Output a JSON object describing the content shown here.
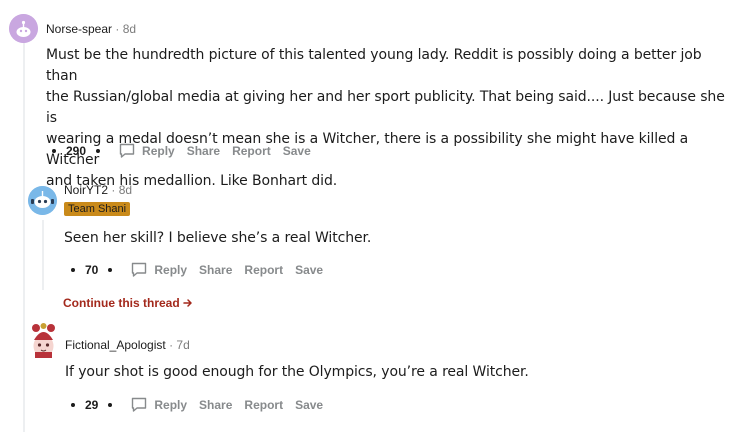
{
  "comments": [
    {
      "author": "Norse-spear",
      "time": "· 8d",
      "lines": [
        "Must be the hundredth picture of this talented young lady. Reddit is possibly doing a better job than",
        "the Russian/global media at giving her and her sport publicity. That being said.... Just because she is",
        "wearing a medal doesn’t mean she is a Witcher, there is a possibility she might have killed a Witcher",
        "and taken his medallion. Like Bonhart did."
      ],
      "score": "290",
      "actions": {
        "reply": "Reply",
        "share": "Share",
        "report": "Report",
        "save": "Save"
      }
    },
    {
      "author": "NoirYT2",
      "time": "· 8d",
      "flair": "Team Shani",
      "lines": [
        "Seen her skill? I believe she’s a real Witcher."
      ],
      "score": "70",
      "actions": {
        "reply": "Reply",
        "share": "Share",
        "report": "Report",
        "save": "Save"
      },
      "continue": "Continue this thread"
    },
    {
      "author": "Fictional_Apologist",
      "time": "· 7d",
      "lines": [
        "If your shot is good enough for the Olympics, you’re a real Witcher."
      ],
      "score": "29",
      "actions": {
        "reply": "Reply",
        "share": "Share",
        "report": "Report",
        "save": "Save"
      }
    }
  ],
  "colors": {
    "flair": "#c98a1a",
    "continue": "#a3291c",
    "action": "#878a8c",
    "avatar1": "#c9a7e0",
    "avatar2": "#7ab8e8"
  }
}
